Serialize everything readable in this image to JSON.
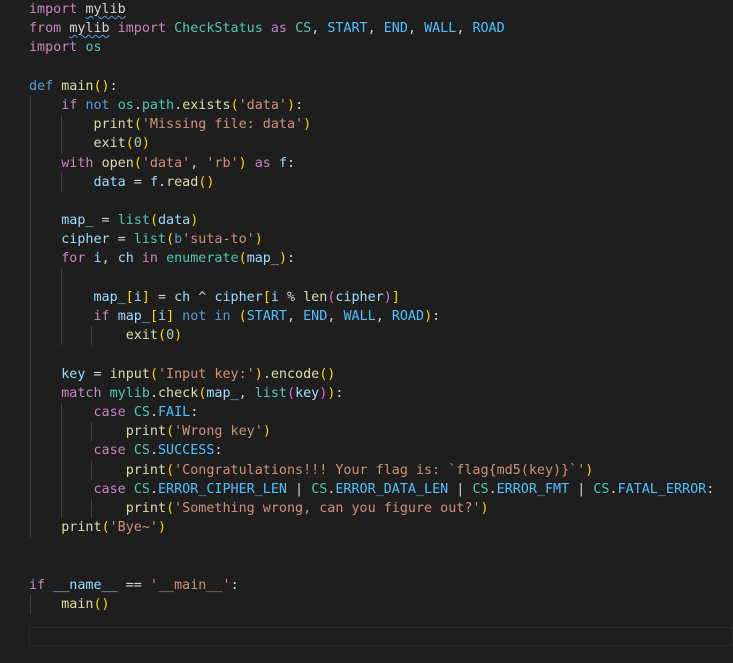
{
  "editor": {
    "line_numbers": [
      "",
      "",
      "",
      "",
      "",
      "",
      "",
      "",
      "",
      "",
      "",
      "",
      "",
      "",
      "",
      "",
      "",
      "",
      "",
      "",
      "",
      "",
      "",
      "",
      "",
      "",
      "",
      "",
      "",
      "",
      "",
      "",
      "",
      ""
    ],
    "lines": [
      {
        "indent": 0,
        "tokens": [
          [
            "import ",
            "ctl"
          ],
          [
            "mylib",
            "sq"
          ]
        ]
      },
      {
        "indent": 0,
        "tokens": [
          [
            "from ",
            "ctl"
          ],
          [
            "mylib",
            "sq"
          ],
          [
            " import ",
            "ctl"
          ],
          [
            "CheckStatus",
            "cls"
          ],
          [
            " as ",
            "ctl"
          ],
          [
            "CS",
            "cls"
          ],
          [
            ", ",
            "pl"
          ],
          [
            "START",
            "const"
          ],
          [
            ", ",
            "pl"
          ],
          [
            "END",
            "const"
          ],
          [
            ", ",
            "pl"
          ],
          [
            "WALL",
            "const"
          ],
          [
            ", ",
            "pl"
          ],
          [
            "ROAD",
            "const"
          ]
        ]
      },
      {
        "indent": 0,
        "tokens": [
          [
            "import ",
            "ctl"
          ],
          [
            "os",
            "cls"
          ]
        ]
      },
      {
        "indent": 0,
        "tokens": []
      },
      {
        "indent": 0,
        "tokens": [
          [
            "def ",
            "kw"
          ],
          [
            "main",
            "fn"
          ],
          [
            "()",
            "b1"
          ],
          [
            ":",
            "pl"
          ]
        ]
      },
      {
        "indent": 1,
        "tokens": [
          [
            "    ",
            "pl"
          ],
          [
            "if ",
            "ctl"
          ],
          [
            "not ",
            "kw"
          ],
          [
            "os",
            "cls"
          ],
          [
            ".",
            "pl"
          ],
          [
            "path",
            "cls"
          ],
          [
            ".",
            "pl"
          ],
          [
            "exists",
            "fn"
          ],
          [
            "(",
            "b1"
          ],
          [
            "'data'",
            "str"
          ],
          [
            ")",
            "b1"
          ],
          [
            ":",
            "pl"
          ]
        ]
      },
      {
        "indent": 2,
        "tokens": [
          [
            "        ",
            "pl"
          ],
          [
            "print",
            "fn"
          ],
          [
            "(",
            "b1"
          ],
          [
            "'Missing file: data'",
            "str"
          ],
          [
            ")",
            "b1"
          ]
        ]
      },
      {
        "indent": 2,
        "tokens": [
          [
            "        ",
            "pl"
          ],
          [
            "exit",
            "fn"
          ],
          [
            "(",
            "b1"
          ],
          [
            "0",
            "num-lit"
          ],
          [
            ")",
            "b1"
          ]
        ]
      },
      {
        "indent": 1,
        "tokens": [
          [
            "    ",
            "pl"
          ],
          [
            "with ",
            "ctl"
          ],
          [
            "open",
            "fn"
          ],
          [
            "(",
            "b1"
          ],
          [
            "'data'",
            "str"
          ],
          [
            ", ",
            "pl"
          ],
          [
            "'rb'",
            "str"
          ],
          [
            ")",
            "b1"
          ],
          [
            " as ",
            "ctl"
          ],
          [
            "f",
            "var"
          ],
          [
            ":",
            "pl"
          ]
        ]
      },
      {
        "indent": 2,
        "tokens": [
          [
            "        ",
            "pl"
          ],
          [
            "data",
            "var"
          ],
          [
            " = ",
            "pl"
          ],
          [
            "f",
            "var"
          ],
          [
            ".",
            "pl"
          ],
          [
            "read",
            "fn"
          ],
          [
            "()",
            "b1"
          ]
        ]
      },
      {
        "indent": 1,
        "tokens": []
      },
      {
        "indent": 1,
        "tokens": [
          [
            "    ",
            "pl"
          ],
          [
            "map_",
            "var"
          ],
          [
            " = ",
            "pl"
          ],
          [
            "list",
            "cls"
          ],
          [
            "(",
            "b1"
          ],
          [
            "data",
            "var"
          ],
          [
            ")",
            "b1"
          ]
        ]
      },
      {
        "indent": 1,
        "tokens": [
          [
            "    ",
            "pl"
          ],
          [
            "cipher",
            "var"
          ],
          [
            " = ",
            "pl"
          ],
          [
            "list",
            "cls"
          ],
          [
            "(",
            "b1"
          ],
          [
            "b",
            "kw"
          ],
          [
            "'suta-to'",
            "str"
          ],
          [
            ")",
            "b1"
          ]
        ]
      },
      {
        "indent": 1,
        "tokens": [
          [
            "    ",
            "pl"
          ],
          [
            "for ",
            "ctl"
          ],
          [
            "i",
            "var"
          ],
          [
            ", ",
            "pl"
          ],
          [
            "ch",
            "var"
          ],
          [
            " in ",
            "ctl"
          ],
          [
            "enumerate",
            "cls"
          ],
          [
            "(",
            "b1"
          ],
          [
            "map_",
            "var"
          ],
          [
            ")",
            "b1"
          ],
          [
            ":",
            "pl"
          ]
        ]
      },
      {
        "indent": 2,
        "tokens": []
      },
      {
        "indent": 2,
        "tokens": [
          [
            "        ",
            "pl"
          ],
          [
            "map_",
            "var"
          ],
          [
            "[",
            "b1"
          ],
          [
            "i",
            "var"
          ],
          [
            "]",
            "b1"
          ],
          [
            " = ",
            "pl"
          ],
          [
            "ch",
            "var"
          ],
          [
            " ^ ",
            "pl"
          ],
          [
            "cipher",
            "var"
          ],
          [
            "[",
            "b1"
          ],
          [
            "i",
            "var"
          ],
          [
            " % ",
            "pl"
          ],
          [
            "len",
            "fn"
          ],
          [
            "(",
            "b2"
          ],
          [
            "cipher",
            "var"
          ],
          [
            ")",
            "b2"
          ],
          [
            "]",
            "b1"
          ]
        ]
      },
      {
        "indent": 2,
        "tokens": [
          [
            "        ",
            "pl"
          ],
          [
            "if ",
            "ctl"
          ],
          [
            "map_",
            "var"
          ],
          [
            "[",
            "b1"
          ],
          [
            "i",
            "var"
          ],
          [
            "]",
            "b1"
          ],
          [
            " not in ",
            "kw"
          ],
          [
            "(",
            "b1"
          ],
          [
            "START",
            "const"
          ],
          [
            ", ",
            "pl"
          ],
          [
            "END",
            "const"
          ],
          [
            ", ",
            "pl"
          ],
          [
            "WALL",
            "const"
          ],
          [
            ", ",
            "pl"
          ],
          [
            "ROAD",
            "const"
          ],
          [
            ")",
            "b1"
          ],
          [
            ":",
            "pl"
          ]
        ]
      },
      {
        "indent": 3,
        "tokens": [
          [
            "            ",
            "pl"
          ],
          [
            "exit",
            "fn"
          ],
          [
            "(",
            "b1"
          ],
          [
            "0",
            "num-lit"
          ],
          [
            ")",
            "b1"
          ]
        ]
      },
      {
        "indent": 1,
        "tokens": []
      },
      {
        "indent": 1,
        "tokens": [
          [
            "    ",
            "pl"
          ],
          [
            "key",
            "var"
          ],
          [
            " = ",
            "pl"
          ],
          [
            "input",
            "fn"
          ],
          [
            "(",
            "b1"
          ],
          [
            "'Input key:'",
            "str"
          ],
          [
            ")",
            "b1"
          ],
          [
            ".",
            "pl"
          ],
          [
            "encode",
            "fn"
          ],
          [
            "()",
            "b1"
          ]
        ]
      },
      {
        "indent": 1,
        "tokens": [
          [
            "    ",
            "pl"
          ],
          [
            "match ",
            "ctl"
          ],
          [
            "mylib",
            "cls"
          ],
          [
            ".",
            "pl"
          ],
          [
            "check",
            "fn"
          ],
          [
            "(",
            "b1"
          ],
          [
            "map_",
            "var"
          ],
          [
            ", ",
            "pl"
          ],
          [
            "list",
            "cls"
          ],
          [
            "(",
            "b2"
          ],
          [
            "key",
            "var"
          ],
          [
            ")",
            "b2"
          ],
          [
            ")",
            "b1"
          ],
          [
            ":",
            "pl"
          ]
        ]
      },
      {
        "indent": 2,
        "tokens": [
          [
            "        ",
            "pl"
          ],
          [
            "case ",
            "ctl"
          ],
          [
            "CS",
            "cls"
          ],
          [
            ".",
            "pl"
          ],
          [
            "FAIL",
            "const"
          ],
          [
            ":",
            "pl"
          ]
        ]
      },
      {
        "indent": 3,
        "tokens": [
          [
            "            ",
            "pl"
          ],
          [
            "print",
            "fn"
          ],
          [
            "(",
            "b1"
          ],
          [
            "'Wrong key'",
            "str"
          ],
          [
            ")",
            "b1"
          ]
        ]
      },
      {
        "indent": 2,
        "tokens": [
          [
            "        ",
            "pl"
          ],
          [
            "case ",
            "ctl"
          ],
          [
            "CS",
            "cls"
          ],
          [
            ".",
            "pl"
          ],
          [
            "SUCCESS",
            "const"
          ],
          [
            ":",
            "pl"
          ]
        ]
      },
      {
        "indent": 3,
        "tokens": [
          [
            "            ",
            "pl"
          ],
          [
            "print",
            "fn"
          ],
          [
            "(",
            "b1"
          ],
          [
            "'Congratulations!!! Your flag is: `flag{md5(key)}`'",
            "str"
          ],
          [
            ")",
            "b1"
          ]
        ]
      },
      {
        "indent": 2,
        "tokens": [
          [
            "        ",
            "pl"
          ],
          [
            "case ",
            "ctl"
          ],
          [
            "CS",
            "cls"
          ],
          [
            ".",
            "pl"
          ],
          [
            "ERROR_CIPHER_LEN",
            "const"
          ],
          [
            " | ",
            "pl"
          ],
          [
            "CS",
            "cls"
          ],
          [
            ".",
            "pl"
          ],
          [
            "ERROR_DATA_LEN",
            "const"
          ],
          [
            " | ",
            "pl"
          ],
          [
            "CS",
            "cls"
          ],
          [
            ".",
            "pl"
          ],
          [
            "ERROR_FMT",
            "const"
          ],
          [
            " | ",
            "pl"
          ],
          [
            "CS",
            "cls"
          ],
          [
            ".",
            "pl"
          ],
          [
            "FATAL_ERROR",
            "const"
          ],
          [
            ":",
            "pl"
          ]
        ]
      },
      {
        "indent": 3,
        "tokens": [
          [
            "            ",
            "pl"
          ],
          [
            "print",
            "fn"
          ],
          [
            "(",
            "b1"
          ],
          [
            "'Something wrong, can you figure out?'",
            "str"
          ],
          [
            ")",
            "b1"
          ]
        ]
      },
      {
        "indent": 1,
        "tokens": [
          [
            "    ",
            "pl"
          ],
          [
            "print",
            "fn"
          ],
          [
            "(",
            "b1"
          ],
          [
            "'Bye~'",
            "str"
          ],
          [
            ")",
            "b1"
          ]
        ]
      },
      {
        "indent": 0,
        "tokens": []
      },
      {
        "indent": 0,
        "tokens": []
      },
      {
        "indent": 0,
        "tokens": [
          [
            "if ",
            "ctl"
          ],
          [
            "__name__",
            "var"
          ],
          [
            " == ",
            "pl"
          ],
          [
            "'__main__'",
            "str"
          ],
          [
            ":",
            "pl"
          ]
        ]
      },
      {
        "indent": 1,
        "tokens": [
          [
            "    ",
            "pl"
          ],
          [
            "main",
            "fn"
          ],
          [
            "()",
            "b1"
          ]
        ]
      },
      {
        "indent": 0,
        "tokens": []
      },
      {
        "indent": 0,
        "tokens": []
      }
    ]
  },
  "colors": {
    "background": "#1e1e1e",
    "keyword": "#569cd6",
    "control": "#c586c0",
    "function": "#dcdcaa",
    "class": "#4ec9b0",
    "variable": "#9cdcfe",
    "constant": "#4fc1ff",
    "string": "#ce9178",
    "number": "#b5cea8"
  }
}
